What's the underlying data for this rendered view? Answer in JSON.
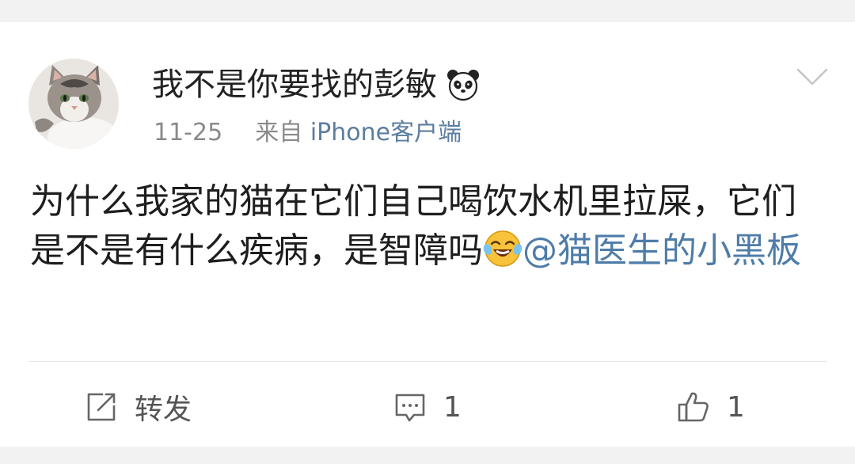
{
  "post": {
    "username": "我不是你要找的彭敏",
    "date": "11-25",
    "source_prefix": "来自",
    "source_app": "iPhone客户端",
    "text_line1": "为什么我家的猫在它们自己喝饮水机里拉",
    "text_line2": "屎，它们是不是有什么疾病，是智障吗",
    "mention_at": "@",
    "mention_name": "猫医生的小黑板"
  },
  "icons": {
    "badge": "panda-icon",
    "menu": "chevron-down-icon",
    "emoji": "laughing-crying-emoji-icon",
    "repost": "repost-icon",
    "comment": "comment-icon",
    "like": "thumbs-up-icon"
  },
  "actions": {
    "repost_label": "转发",
    "comment_count": "1",
    "like_count": "1"
  },
  "colors": {
    "background": "#f2f2f2",
    "card": "#ffffff",
    "link": "#4e7ca8",
    "meta": "#8a8a8a",
    "emoji": "#f8c23a"
  }
}
